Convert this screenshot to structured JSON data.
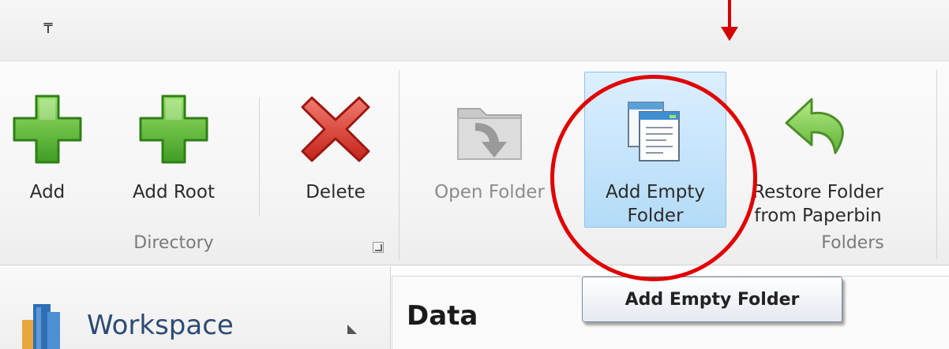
{
  "quick_access": {
    "customize_icon": "customize-qat-icon",
    "glyph": "₸"
  },
  "ribbon": {
    "directory_group": {
      "label": "Directory",
      "buttons": [
        {
          "label": "Add",
          "icon": "green-plus-icon"
        },
        {
          "label": "Add Root",
          "icon": "green-plus-icon"
        },
        {
          "label": "Delete",
          "icon": "red-x-icon"
        }
      ]
    },
    "folders_group": {
      "label": "Folders",
      "buttons": [
        {
          "label": "Open Folder",
          "icon": "open-folder-icon",
          "disabled": true
        },
        {
          "label": "Add Empty\nFolder",
          "icon": "add-empty-folder-icon",
          "selected": true
        },
        {
          "label": "Restore Folder\nfrom Paperbin",
          "icon": "restore-arrow-icon"
        }
      ]
    }
  },
  "panels": {
    "workspace": {
      "label": "Workspace"
    },
    "data": {
      "title": "Data"
    }
  },
  "tooltip": {
    "text": "Add Empty Folder"
  },
  "annotation_color": "#e00000",
  "selection_color": "#c5e4fb"
}
